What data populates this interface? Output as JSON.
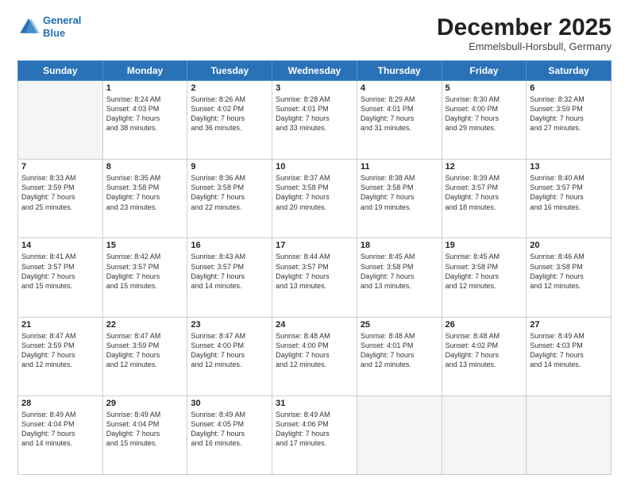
{
  "logo": {
    "line1": "General",
    "line2": "Blue"
  },
  "header": {
    "title": "December 2025",
    "subtitle": "Emmelsbull-Horsbull, Germany"
  },
  "weekdays": [
    "Sunday",
    "Monday",
    "Tuesday",
    "Wednesday",
    "Thursday",
    "Friday",
    "Saturday"
  ],
  "weeks": [
    [
      {
        "day": "",
        "info": ""
      },
      {
        "day": "1",
        "info": "Sunrise: 8:24 AM\nSunset: 4:03 PM\nDaylight: 7 hours\nand 38 minutes."
      },
      {
        "day": "2",
        "info": "Sunrise: 8:26 AM\nSunset: 4:02 PM\nDaylight: 7 hours\nand 36 minutes."
      },
      {
        "day": "3",
        "info": "Sunrise: 8:28 AM\nSunset: 4:01 PM\nDaylight: 7 hours\nand 33 minutes."
      },
      {
        "day": "4",
        "info": "Sunrise: 8:29 AM\nSunset: 4:01 PM\nDaylight: 7 hours\nand 31 minutes."
      },
      {
        "day": "5",
        "info": "Sunrise: 8:30 AM\nSunset: 4:00 PM\nDaylight: 7 hours\nand 29 minutes."
      },
      {
        "day": "6",
        "info": "Sunrise: 8:32 AM\nSunset: 3:59 PM\nDaylight: 7 hours\nand 27 minutes."
      }
    ],
    [
      {
        "day": "7",
        "info": "Sunrise: 8:33 AM\nSunset: 3:59 PM\nDaylight: 7 hours\nand 25 minutes."
      },
      {
        "day": "8",
        "info": "Sunrise: 8:35 AM\nSunset: 3:58 PM\nDaylight: 7 hours\nand 23 minutes."
      },
      {
        "day": "9",
        "info": "Sunrise: 8:36 AM\nSunset: 3:58 PM\nDaylight: 7 hours\nand 22 minutes."
      },
      {
        "day": "10",
        "info": "Sunrise: 8:37 AM\nSunset: 3:58 PM\nDaylight: 7 hours\nand 20 minutes."
      },
      {
        "day": "11",
        "info": "Sunrise: 8:38 AM\nSunset: 3:58 PM\nDaylight: 7 hours\nand 19 minutes."
      },
      {
        "day": "12",
        "info": "Sunrise: 8:39 AM\nSunset: 3:57 PM\nDaylight: 7 hours\nand 18 minutes."
      },
      {
        "day": "13",
        "info": "Sunrise: 8:40 AM\nSunset: 3:57 PM\nDaylight: 7 hours\nand 16 minutes."
      }
    ],
    [
      {
        "day": "14",
        "info": "Sunrise: 8:41 AM\nSunset: 3:57 PM\nDaylight: 7 hours\nand 15 minutes."
      },
      {
        "day": "15",
        "info": "Sunrise: 8:42 AM\nSunset: 3:57 PM\nDaylight: 7 hours\nand 15 minutes."
      },
      {
        "day": "16",
        "info": "Sunrise: 8:43 AM\nSunset: 3:57 PM\nDaylight: 7 hours\nand 14 minutes."
      },
      {
        "day": "17",
        "info": "Sunrise: 8:44 AM\nSunset: 3:57 PM\nDaylight: 7 hours\nand 13 minutes."
      },
      {
        "day": "18",
        "info": "Sunrise: 8:45 AM\nSunset: 3:58 PM\nDaylight: 7 hours\nand 13 minutes."
      },
      {
        "day": "19",
        "info": "Sunrise: 8:45 AM\nSunset: 3:58 PM\nDaylight: 7 hours\nand 12 minutes."
      },
      {
        "day": "20",
        "info": "Sunrise: 8:46 AM\nSunset: 3:58 PM\nDaylight: 7 hours\nand 12 minutes."
      }
    ],
    [
      {
        "day": "21",
        "info": "Sunrise: 8:47 AM\nSunset: 3:59 PM\nDaylight: 7 hours\nand 12 minutes."
      },
      {
        "day": "22",
        "info": "Sunrise: 8:47 AM\nSunset: 3:59 PM\nDaylight: 7 hours\nand 12 minutes."
      },
      {
        "day": "23",
        "info": "Sunrise: 8:47 AM\nSunset: 4:00 PM\nDaylight: 7 hours\nand 12 minutes."
      },
      {
        "day": "24",
        "info": "Sunrise: 8:48 AM\nSunset: 4:00 PM\nDaylight: 7 hours\nand 12 minutes."
      },
      {
        "day": "25",
        "info": "Sunrise: 8:48 AM\nSunset: 4:01 PM\nDaylight: 7 hours\nand 12 minutes."
      },
      {
        "day": "26",
        "info": "Sunrise: 8:48 AM\nSunset: 4:02 PM\nDaylight: 7 hours\nand 13 minutes."
      },
      {
        "day": "27",
        "info": "Sunrise: 8:49 AM\nSunset: 4:03 PM\nDaylight: 7 hours\nand 14 minutes."
      }
    ],
    [
      {
        "day": "28",
        "info": "Sunrise: 8:49 AM\nSunset: 4:04 PM\nDaylight: 7 hours\nand 14 minutes."
      },
      {
        "day": "29",
        "info": "Sunrise: 8:49 AM\nSunset: 4:04 PM\nDaylight: 7 hours\nand 15 minutes."
      },
      {
        "day": "30",
        "info": "Sunrise: 8:49 AM\nSunset: 4:05 PM\nDaylight: 7 hours\nand 16 minutes."
      },
      {
        "day": "31",
        "info": "Sunrise: 8:49 AM\nSunset: 4:06 PM\nDaylight: 7 hours\nand 17 minutes."
      },
      {
        "day": "",
        "info": ""
      },
      {
        "day": "",
        "info": ""
      },
      {
        "day": "",
        "info": ""
      }
    ]
  ]
}
